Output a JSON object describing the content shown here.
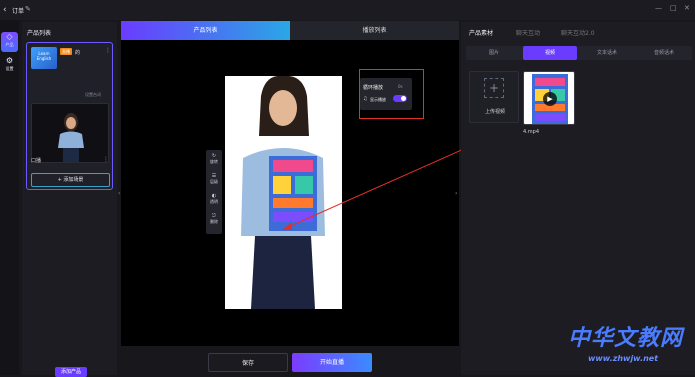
{
  "titlebar": {
    "back_icon": "chevron-left-icon",
    "title": "订单",
    "edit_icon": "pencil-icon",
    "window_controls": [
      "minimize-icon",
      "maximize-icon",
      "close-icon"
    ]
  },
  "rail": {
    "items": [
      {
        "label": "产品",
        "icon": "cube-icon",
        "active": true
      },
      {
        "label": "设置",
        "icon": "gear-icon",
        "active": false
      }
    ]
  },
  "left_panel": {
    "title": "产品列表",
    "product": {
      "tag": "直播",
      "name": "的",
      "thumb_text": "Learn English",
      "link": "设置台词",
      "more": "⋮"
    },
    "scene": {
      "label": "口播",
      "more": "⋮"
    },
    "add_scene_label": "添加场景",
    "add_product_label": "添加产品"
  },
  "center": {
    "tabs": [
      {
        "label": "产品列表",
        "active": true
      },
      {
        "label": "播放列表",
        "active": false
      }
    ],
    "tools": [
      {
        "label": "旋转",
        "icon": "rotate-icon"
      },
      {
        "label": "层级",
        "icon": "layers-icon"
      },
      {
        "label": "透明",
        "icon": "opacity-icon"
      },
      {
        "label": "删除",
        "icon": "trash-icon"
      }
    ],
    "popover": {
      "loop_label": "循环播放",
      "loop_value": "0s",
      "show_label": "显示播放",
      "show_enabled": true
    }
  },
  "buttons": {
    "save": "保存",
    "start_live": "开始直播"
  },
  "right_panel": {
    "tabs": [
      {
        "label": "产品素材",
        "active": true
      },
      {
        "label": "聊天互动",
        "active": false
      },
      {
        "label": "聊天互动2.0",
        "active": false
      }
    ],
    "subtabs": [
      {
        "label": "图片",
        "active": false
      },
      {
        "label": "视频",
        "active": true
      },
      {
        "label": "文本话术",
        "active": false
      },
      {
        "label": "音频话术",
        "active": false
      }
    ],
    "upload_label": "上传视频",
    "video_name": "4.mp4"
  },
  "watermark": {
    "brand": "中华文教网",
    "url": "www.zhwjw.net"
  },
  "colors": {
    "accent": "#6a3cff",
    "highlight": "#e0302a"
  }
}
